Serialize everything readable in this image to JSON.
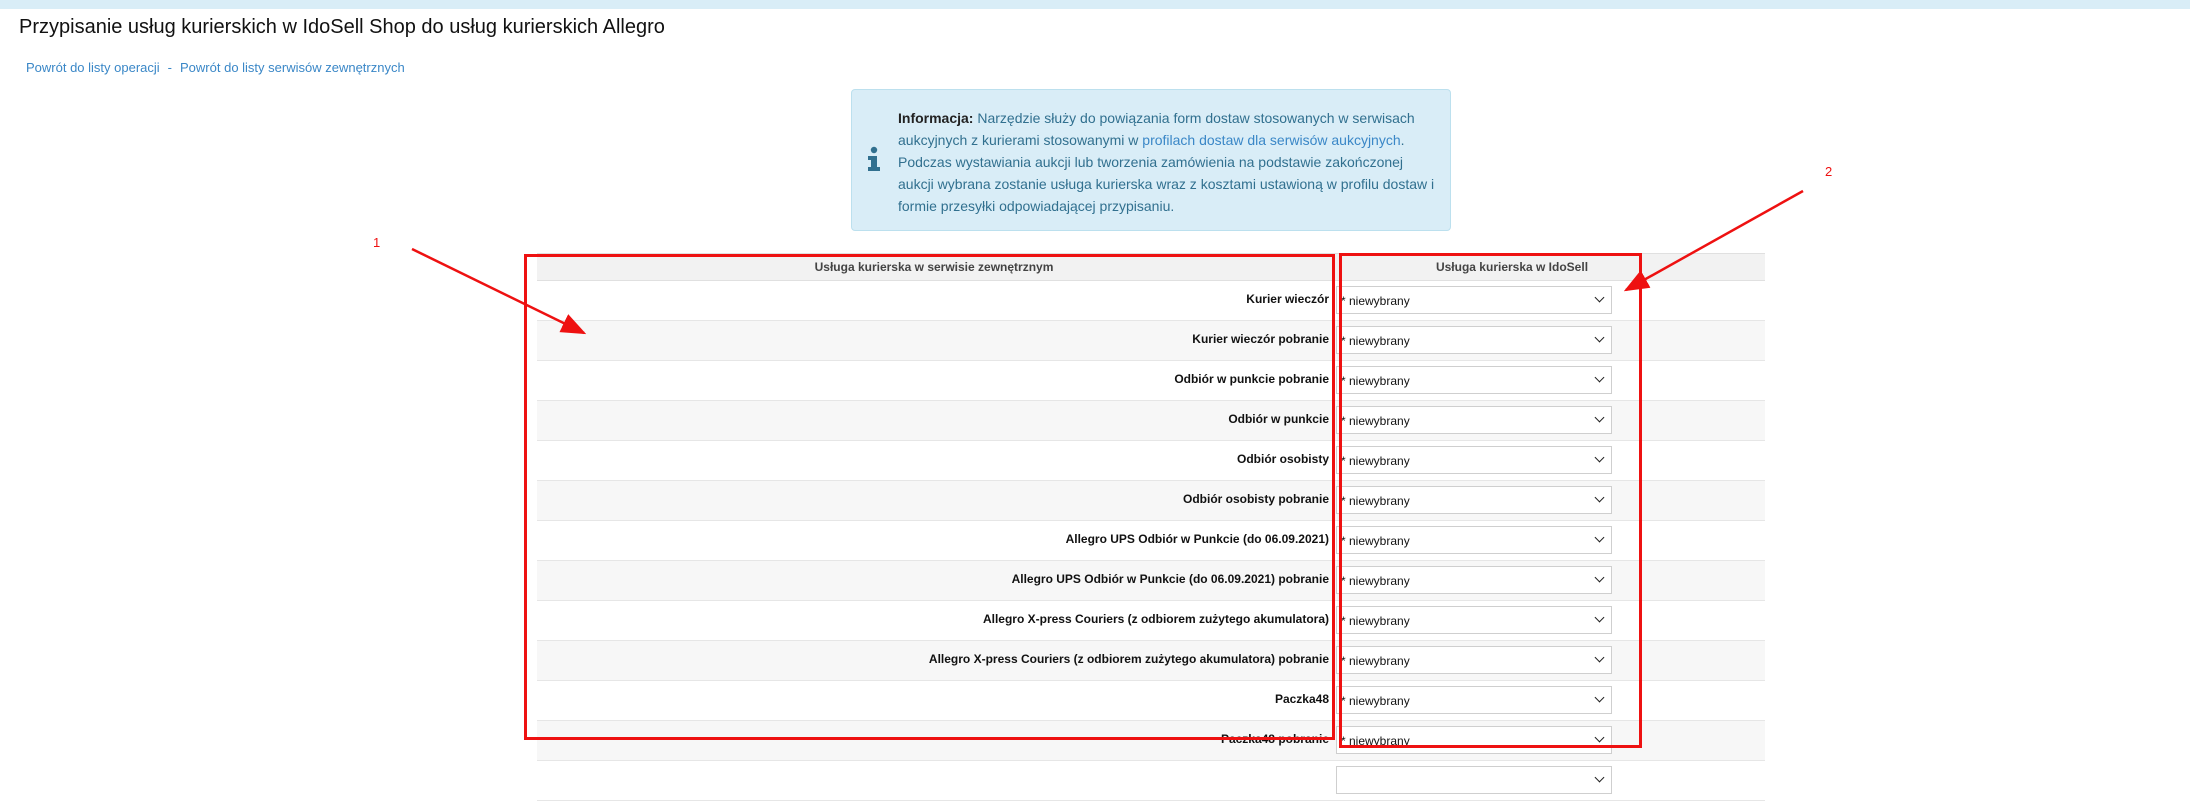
{
  "page": {
    "title": "Przypisanie usług kurierskich w IdoSell Shop do usług kurierskich Allegro"
  },
  "breadcrumb": {
    "link1": "Powrót do listy operacji",
    "separator": "-",
    "link2": "Powrót do listy serwisów zewnętrznych"
  },
  "info": {
    "icon": "info-icon",
    "bold": "Informacja:",
    "text1": " Narzędzie służy do powiązania form dostaw stosowanych w serwisach aukcyjnych z kurierami stosowanymi w ",
    "link": "profilach dostaw dla serwisów aukcyjnych",
    "text2": ". Podczas wystawiania aukcji lub tworzenia zamówienia na podstawie zakończonej aukcji wybrana zostanie usługa kurierska wraz z kosztami ustawioną w profilu dostaw i formie przesyłki odpowiadającej przypisaniu."
  },
  "table": {
    "header_external": "Usługa kurierska w serwisie zewnętrznym",
    "header_idosell": "Usługa kurierska w IdoSell",
    "rows": [
      {
        "label": "Kurier wieczór",
        "value": "* niewybrany"
      },
      {
        "label": "Kurier wieczór pobranie",
        "value": "* niewybrany"
      },
      {
        "label": "Odbiór w punkcie pobranie",
        "value": "* niewybrany"
      },
      {
        "label": "Odbiór w punkcie",
        "value": "* niewybrany"
      },
      {
        "label": "Odbiór osobisty",
        "value": "* niewybrany"
      },
      {
        "label": "Odbiór osobisty pobranie",
        "value": "* niewybrany"
      },
      {
        "label": "Allegro UPS Odbiór w Punkcie (do 06.09.2021)",
        "value": "* niewybrany"
      },
      {
        "label": "Allegro UPS Odbiór w Punkcie (do 06.09.2021) pobranie",
        "value": "* niewybrany"
      },
      {
        "label": "Allegro X-press Couriers (z odbiorem zużytego akumulatora)",
        "value": "* niewybrany"
      },
      {
        "label": "Allegro X-press Couriers (z odbiorem zużytego akumulatora) pobranie",
        "value": "* niewybrany"
      },
      {
        "label": "Paczka48",
        "value": "* niewybrany"
      },
      {
        "label": "Paczka48 pobranie",
        "value": "* niewybrany"
      },
      {
        "label": "",
        "value": ""
      }
    ]
  },
  "annotations": {
    "label1": "1",
    "label2": "2",
    "color": "#ee1111"
  }
}
